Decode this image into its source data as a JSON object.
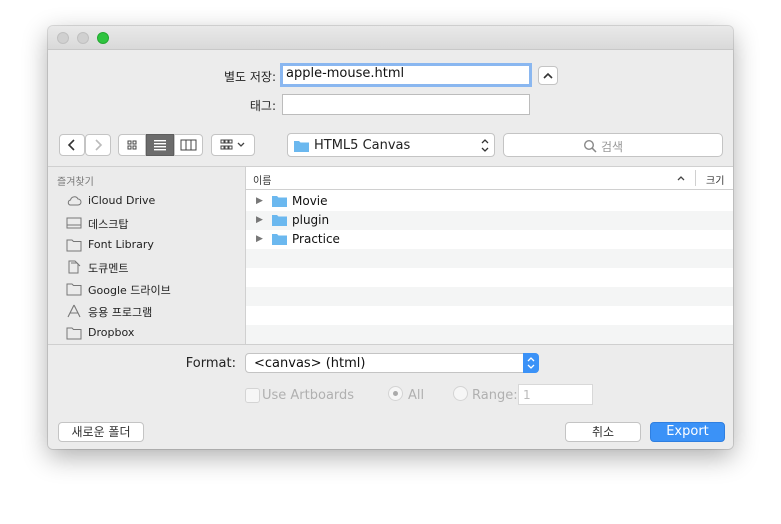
{
  "dialog": {
    "save_as_label": "별도 저장:",
    "filename": "apple-mouse.html",
    "tags_label": "태그:",
    "tags_value": ""
  },
  "toolbar": {
    "location": "HTML5 Canvas",
    "search_placeholder": "검색"
  },
  "sidebar": {
    "header": "즐겨찾기",
    "items": [
      {
        "label": "iCloud Drive",
        "icon": "cloud-icon"
      },
      {
        "label": "데스크탑",
        "icon": "desktop-icon"
      },
      {
        "label": "Font Library",
        "icon": "folder-icon"
      },
      {
        "label": "도큐멘트",
        "icon": "documents-icon"
      },
      {
        "label": "Google 드라이브",
        "icon": "folder-icon"
      },
      {
        "label": "응용 프로그램",
        "icon": "applications-icon"
      },
      {
        "label": "Dropbox",
        "icon": "folder-icon"
      }
    ]
  },
  "filelist": {
    "col_name": "이름",
    "col_size": "크기",
    "rows": [
      {
        "name": "Movie"
      },
      {
        "name": "plugin"
      },
      {
        "name": "Practice"
      }
    ]
  },
  "options": {
    "format_label": "Format:",
    "format_value": "<canvas> (html)",
    "use_artboards": "Use Artboards",
    "all_label": "All",
    "range_label": "Range:",
    "range_value": "1"
  },
  "buttons": {
    "new_folder": "새로운 폴더",
    "cancel": "취소",
    "export": "Export"
  },
  "colors": {
    "accent": "#3b92f7",
    "folder": "#6bb8ef",
    "close_zoom_green": "#2fc43f"
  }
}
